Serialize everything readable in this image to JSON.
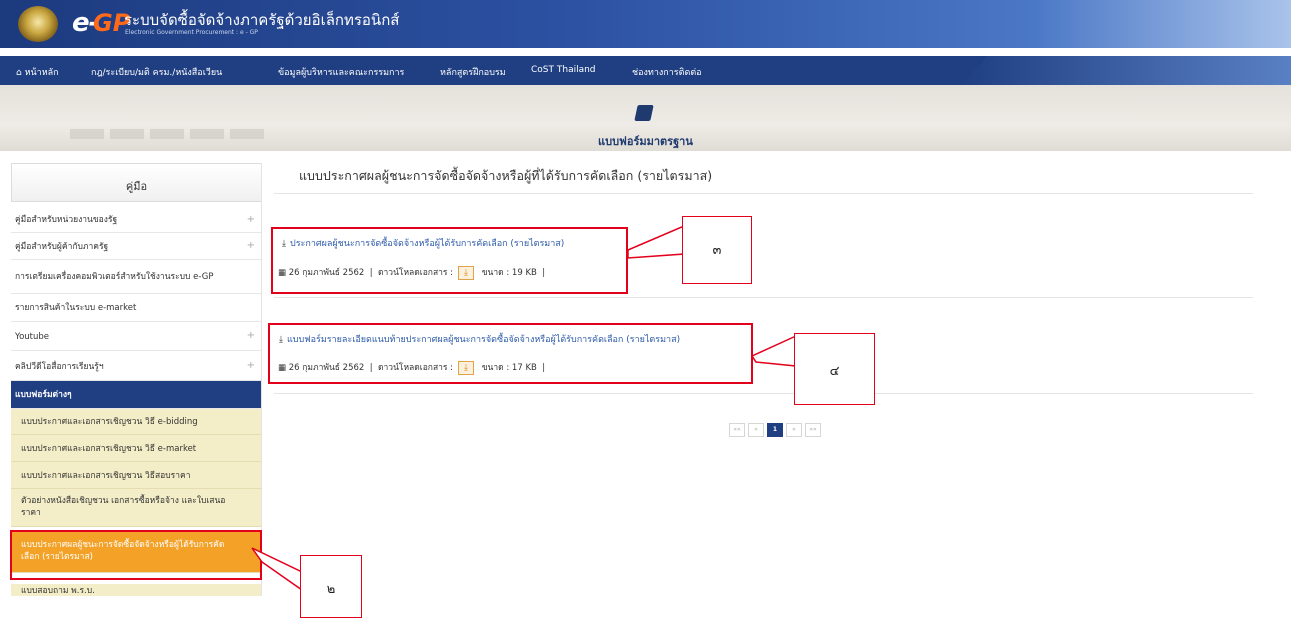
{
  "header": {
    "logo_e": "e-",
    "logo_gp": "GP",
    "title": "ระบบจัดซื้อจัดจ้างภาครัฐด้วยอิเล็กทรอนิกส์",
    "subtitle": "Electronic Government Procurement : e - GP"
  },
  "nav": {
    "items": [
      {
        "label": "หน้าหลัก"
      },
      {
        "label": "กฎ/ระเบียบ/มติ ครม./หนังสือเวียน"
      },
      {
        "label": "ข้อมูลผู้บริหารและคณะกรรมการ"
      },
      {
        "label": "หลักสูตรฝึกอบรม"
      },
      {
        "label": "CoST Thailand"
      },
      {
        "label": "ช่องทางการติดต่อ"
      }
    ],
    "home_icon": "home-icon"
  },
  "banner": {
    "title": "แบบฟอร์มมาตรฐาน",
    "icon": "book-icon"
  },
  "sidebar": {
    "heading": "คู่มือ",
    "items": [
      {
        "label": "คู่มือสำหรับหน่วยงานของรัฐ",
        "plus": "+"
      },
      {
        "label": "คู่มือสำหรับผู้ค้ากับภาครัฐ",
        "plus": "+"
      },
      {
        "label": "การเตรียมเครื่องคอมพิวเตอร์สำหรับใช้งานระบบ e-GP",
        "plus": ""
      },
      {
        "label": "รายการสินค้าในระบบ e-market",
        "plus": ""
      },
      {
        "label": "Youtube",
        "plus": "+"
      },
      {
        "label": "คลิปวีดีโอสื่อการเรียนรู้ฯ",
        "plus": "+"
      },
      {
        "label": "แบบฟอร์มต่างๆ",
        "plus": ""
      }
    ],
    "subitems": [
      {
        "label": "แบบประกาศและเอกสารเชิญชวน วิธี e-bidding"
      },
      {
        "label": "แบบประกาศและเอกสารเชิญชวน วิธี e-market"
      },
      {
        "label": "แบบประกาศและเอกสารเชิญชวน วิธีสอบราคา"
      },
      {
        "label": "ตัวอย่างหนังสือเชิญชวน เอกสารซื้อหรือจ้าง และใบเสนอราคา"
      },
      {
        "label": "แบบประกาศผลผู้ชนะการจัดซื้อจัดจ้างหรือผู้ได้รับการคัดเลือก (รายไตรมาส)"
      },
      {
        "label": "แบบสอบถาม พ.ร.บ."
      }
    ]
  },
  "main": {
    "title": "แบบประกาศผลผู้ชนะการจัดซื้อจัดจ้างหรือผู้ที่ได้รับการคัดเลือก (รายไตรมาส)",
    "documents": [
      {
        "name": "ประกาศผลผู้ชนะการจัดซื้อจัดจ้างหรือผู้ได้รับการคัดเลือก (รายไตรมาส)",
        "date": "26 กุมภาพันธ์ 2562",
        "download_label": "ดาวน์โหลดเอกสาร :",
        "size": "ขนาด : 19 KB",
        "sep": "|"
      },
      {
        "name": "แบบฟอร์มรายละเอียดแนบท้ายประกาศผลผู้ชนะการจัดซื้อจัดจ้างหรือผู้ได้รับการคัดเลือก (รายไตรมาส)",
        "date": "26 กุมภาพันธ์ 2562",
        "download_label": "ดาวน์โหลดเอกสาร :",
        "size": "ขนาด : 17 KB",
        "sep": "|"
      }
    ],
    "pagination": {
      "first": "««",
      "prev": "«",
      "current": "1",
      "next": "»",
      "last": "»»"
    }
  },
  "callouts": {
    "c2": "๒",
    "c3": "๓",
    "c4": "๔"
  },
  "colors": {
    "nav_bg": "#1f3f82",
    "highlight": "#e3001b",
    "selected_item": "#f3a127",
    "sub_item_bg": "#f4eec8"
  }
}
